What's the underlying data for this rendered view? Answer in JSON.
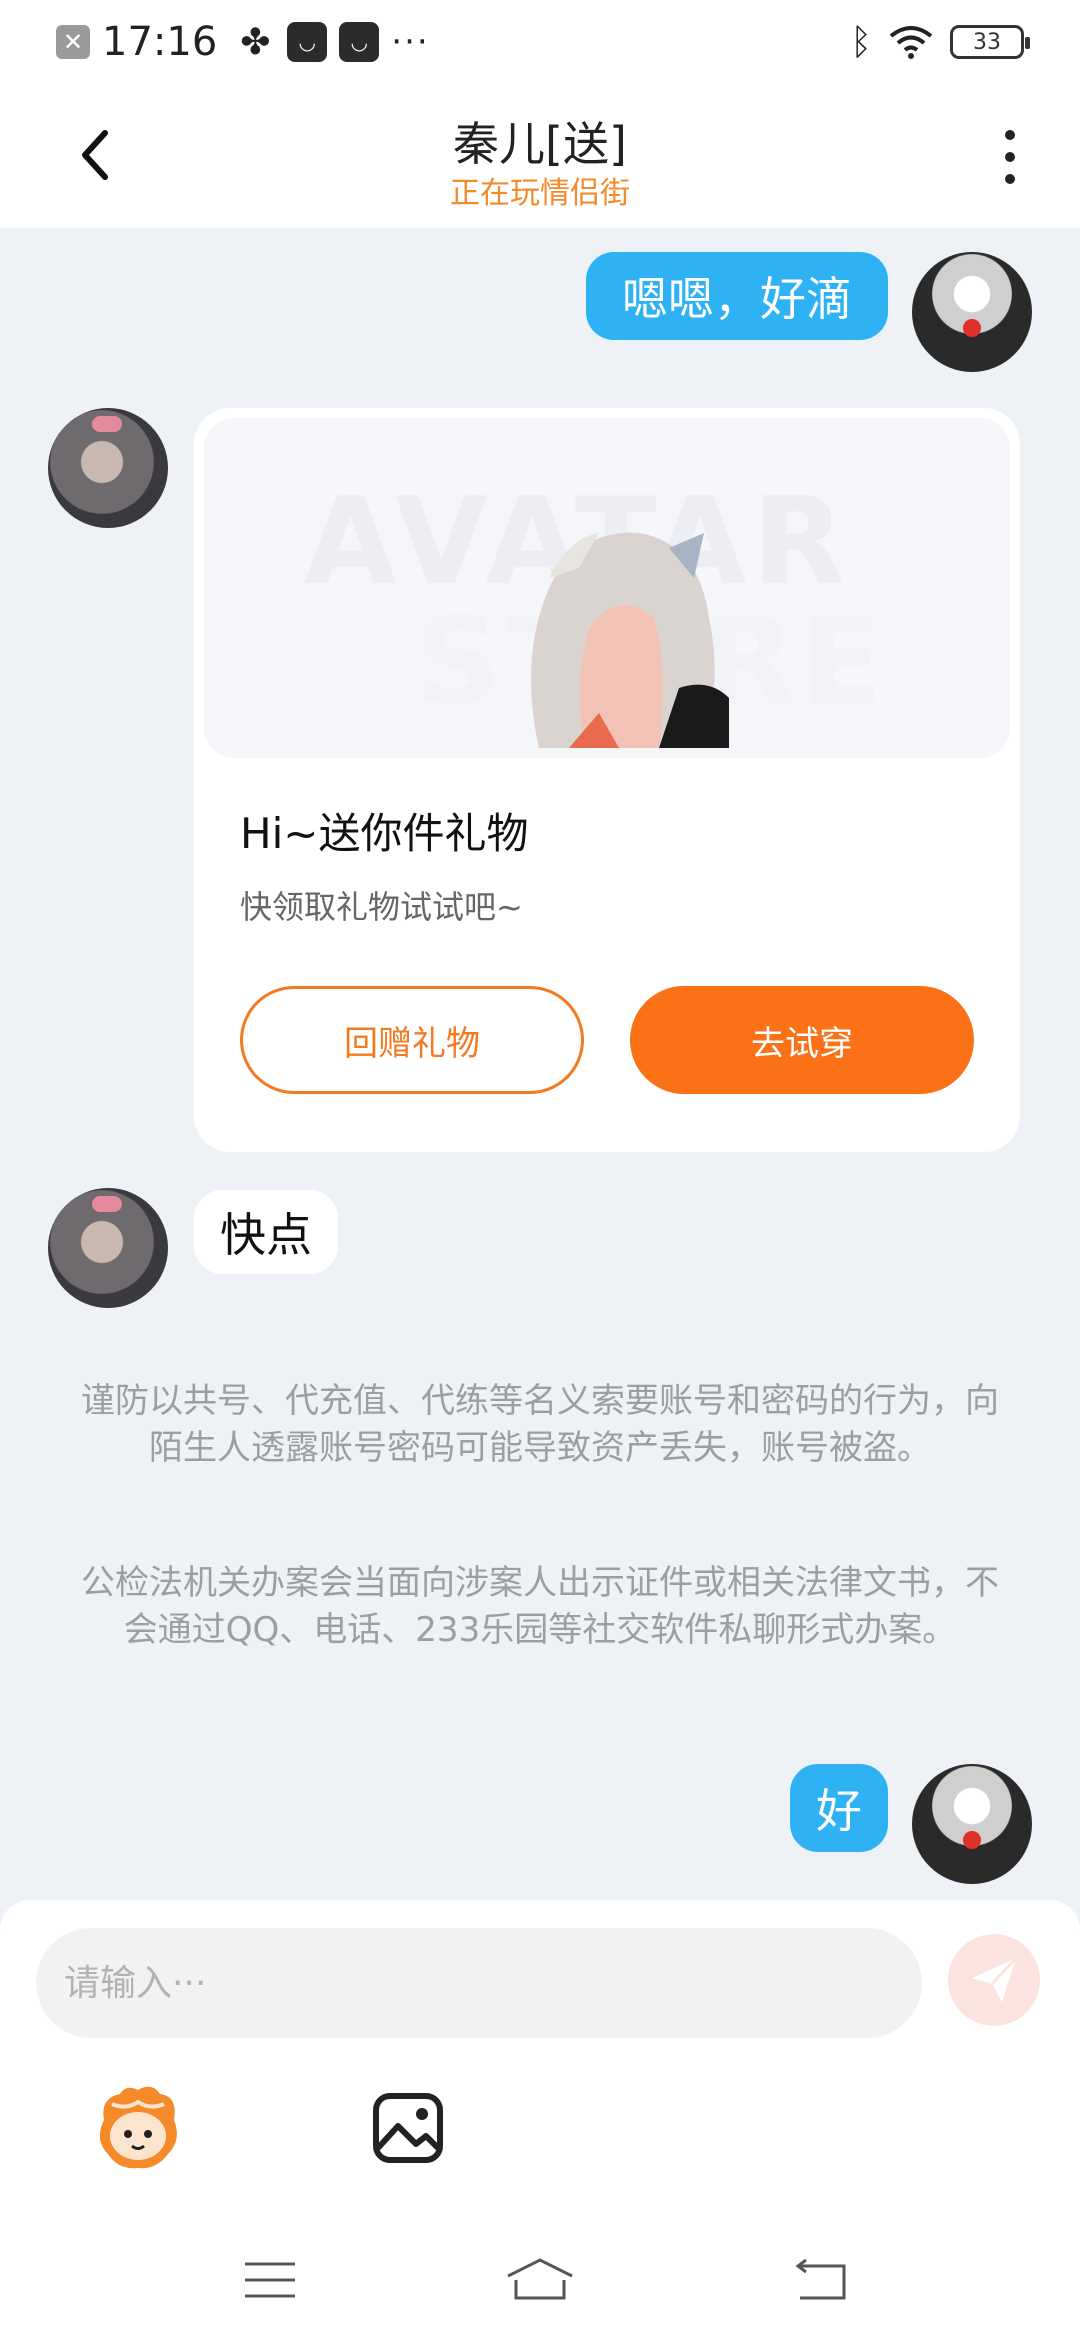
{
  "status_bar": {
    "time": "17:16",
    "dots": "···",
    "battery": "33",
    "icons": [
      "notification-off-icon",
      "pinwheel-icon",
      "bag-icon",
      "bag-icon",
      "bluetooth-icon",
      "wifi-icon",
      "battery-icon"
    ]
  },
  "header": {
    "title": "秦儿[送]",
    "subtitle": "正在玩情侣街",
    "subtitle_color": "#f48a2a"
  },
  "messages": {
    "sent_1": "嗯嗯，好滴",
    "received_text": "快点",
    "sent_2": "好"
  },
  "gift_card": {
    "watermark_line1": "AVATAR",
    "watermark_line2": "STORE",
    "title": "Hi~送你件礼物",
    "subtitle": "快领取礼物试试吧~",
    "return_button": "回赠礼物",
    "try_button": "去试穿"
  },
  "notices": {
    "warning_1": "谨防以共号、代充值、代练等名义索要账号和密码的行为，向陌生人透露账号密码可能导致资产丢失，账号被盗。",
    "warning_2": "公检法机关办案会当面向涉案人出示证件或相关法律文书，不会通过QQ、电话、233乐园等社交软件私聊形式办案。"
  },
  "input": {
    "placeholder": "请输入···"
  },
  "colors": {
    "bubble_blue": "#2fb2f3",
    "accent_orange": "#fb7116",
    "background": "#eef1f6"
  }
}
